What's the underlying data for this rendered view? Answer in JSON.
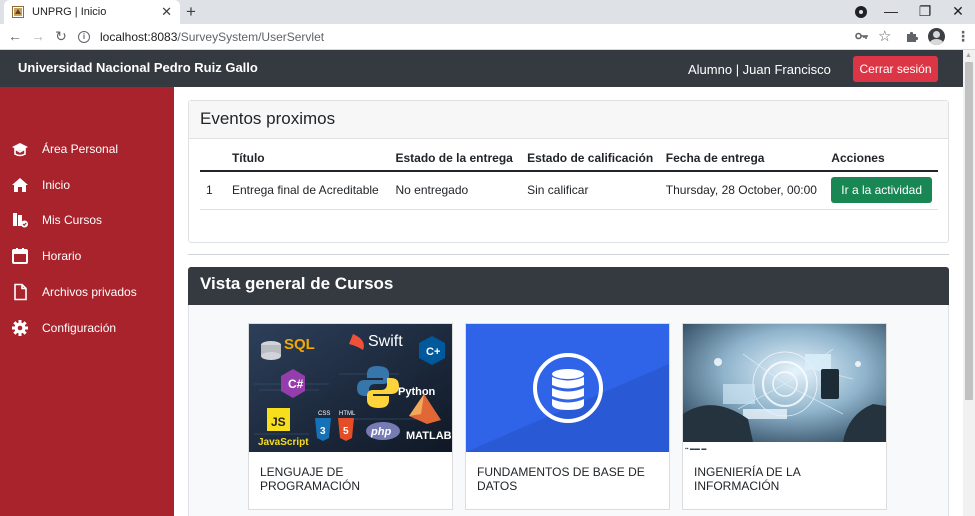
{
  "browser": {
    "tab_title": "UNPRG | Inicio",
    "new_tab": "+",
    "url_host": "localhost:8083",
    "url_path": "/SurveySystem/UserServlet",
    "window_controls": {
      "minimize": "—",
      "restore": "❐",
      "close": "✕"
    }
  },
  "navbar": {
    "brand": "Universidad Nacional Pedro Ruiz Gallo",
    "user": "Alumno | Juan Francisco",
    "logout": "Cerrar sesión"
  },
  "sidebar": {
    "items": [
      {
        "label": "Área Personal",
        "icon": "graduation-cap-icon"
      },
      {
        "label": "Inicio",
        "icon": "home-icon"
      },
      {
        "label": "Mis Cursos",
        "icon": "courses-icon"
      },
      {
        "label": "Horario",
        "icon": "calendar-icon"
      },
      {
        "label": "Archivos privados",
        "icon": "file-icon"
      },
      {
        "label": "Configuración",
        "icon": "gear-icon"
      }
    ]
  },
  "events": {
    "title": "Eventos proximos",
    "columns": [
      "Título",
      "Estado de la entrega",
      "Estado de calificación",
      "Fecha de entrega",
      "Acciones"
    ],
    "rows": [
      {
        "num": "1",
        "title": "Entrega final de Acreditable",
        "delivery": "No entregado",
        "grading": "Sin calificar",
        "due": "Thursday, 28 October, 00:00",
        "action": "Ir a la actividad"
      }
    ]
  },
  "courses": {
    "title": "Vista general de Cursos",
    "items": [
      {
        "name": "LENGUAJE DE PROGRAMACIÓN",
        "image_labels": [
          "SQL",
          "Swift",
          "C++",
          "C#",
          "Python",
          "JS",
          "JavaScript",
          "CSS",
          "HTML",
          "php",
          "MATLAB"
        ]
      },
      {
        "name": "FUNDAMENTOS DE BASE DE DATOS"
      },
      {
        "name": "INGENIERÍA DE LA INFORMACIÓN"
      }
    ]
  },
  "colors": {
    "sidebar": "#a8232b",
    "navbar": "#343a40",
    "logout": "#dc3545",
    "action": "#198754",
    "db_blue": "#2f63e8"
  }
}
